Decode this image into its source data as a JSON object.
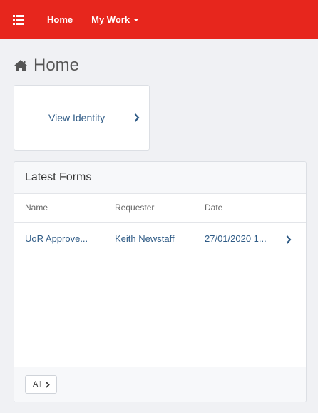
{
  "navbar": {
    "background": "#e7261d",
    "menu_icon": "list-menu-icon",
    "home_label": "Home",
    "mywork_label": "My Work"
  },
  "page": {
    "title": "Home",
    "title_icon": "home-icon"
  },
  "tiles": [
    {
      "label": "View Identity",
      "icon": "chevron-right-icon"
    }
  ],
  "latest_forms": {
    "title": "Latest Forms",
    "columns": [
      "Name",
      "Requester",
      "Date"
    ],
    "rows": [
      {
        "name": "UoR Approve...",
        "requester": "Keith Newstaff",
        "date": "27/01/2020 1..."
      }
    ],
    "footer_button": "All"
  },
  "colors": {
    "link": "#2f5b86",
    "page_background": "#f0f1f4"
  }
}
